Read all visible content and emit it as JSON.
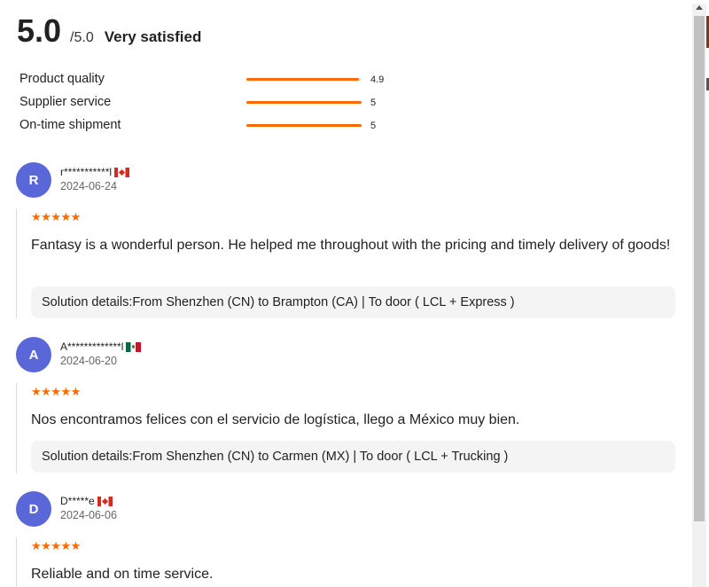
{
  "summary": {
    "score": "5.0",
    "max": "/5.0",
    "satisfaction": "Very satisfied"
  },
  "metrics": [
    {
      "label": "Product quality",
      "value": "4.9",
      "fraction": 0.98
    },
    {
      "label": "Supplier service",
      "value": "5",
      "fraction": 1.0
    },
    {
      "label": "On-time shipment",
      "value": "5",
      "fraction": 1.0
    }
  ],
  "reviews": [
    {
      "initial": "R",
      "name": "r***********l",
      "flag": "flag-canada-icon",
      "date": "2024-06-24",
      "stars": "★★★★★",
      "rating": 5,
      "text": "Fantasy is a wonderful person. He helped me throughout with the pricing and timely delivery of goods!",
      "solution": "Solution details:From Shenzhen (CN) to Brampton (CA)  | To door ( LCL + Express )"
    },
    {
      "initial": "A",
      "name": "A*************l",
      "flag": "flag-mexico-icon",
      "date": "2024-06-20",
      "stars": "★★★★★",
      "rating": 5,
      "text": "Nos encontramos felices con el servicio de logística, llego a México muy bien.",
      "solution": "Solution details:From Shenzhen (CN) to Carmen (MX)  | To door ( LCL + Trucking )"
    },
    {
      "initial": "D",
      "name": "D*****e",
      "flag": "flag-canada-icon",
      "date": "2024-06-06",
      "stars": "★★★★★",
      "rating": 5,
      "text": "Reliable and on time service.",
      "solution": ""
    }
  ],
  "colors": {
    "accent": "#ff6a00",
    "avatar": "#5a67d8",
    "solution_bg": "#f4f4f4"
  }
}
